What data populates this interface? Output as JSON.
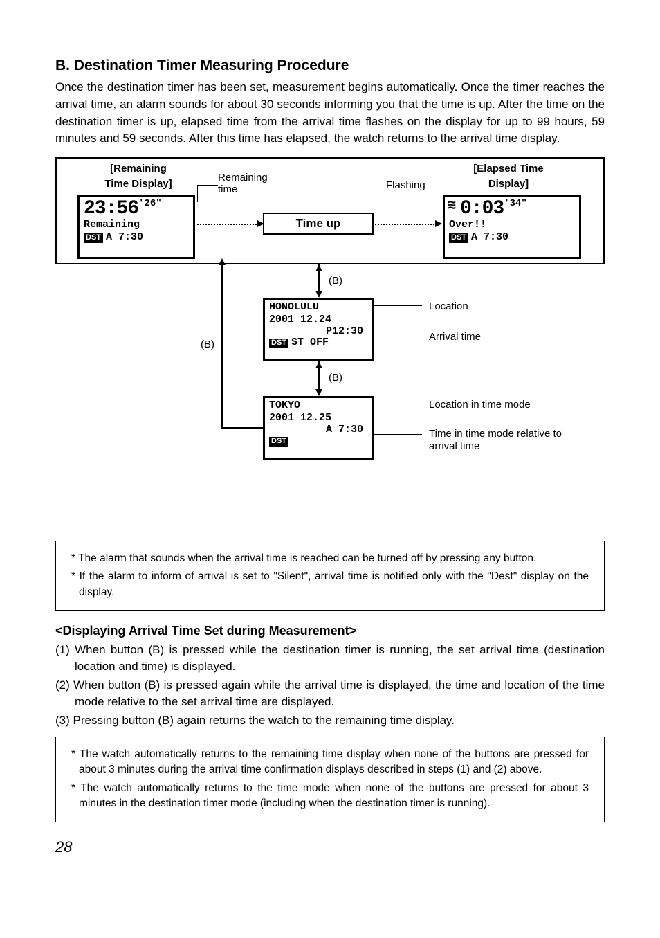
{
  "section": {
    "heading": "B. Destination Timer Measuring Procedure",
    "intro": "Once the destination timer has been set, measurement begins automatically.  Once the timer reaches the arrival time, an alarm sounds for about 30 seconds informing you that the time is up.  After the time on the destination timer is up, elapsed time from the arrival time flashes on the display for up to 99 hours, 59 minutes and 59 seconds.  After this time has elapsed, the watch returns to the arrival time display."
  },
  "labels": {
    "remaining_title1": "[Remaining",
    "remaining_title2": "Time Display]",
    "elapsed_title1": "[Elapsed Time",
    "elapsed_title2": "Display]",
    "remaining_time": "Remaining time",
    "flashing": "Flashing",
    "time_up": "Time up",
    "b": "(B)",
    "location": "Location",
    "arrival_time": "Arrival time",
    "loc_in_time_mode": "Location in time mode",
    "time_mode_rel": "Time in time mode relative to arrival time"
  },
  "lcd": {
    "remaining": {
      "main": "23:56",
      "sec": "'26\"",
      "line2": "Remaining",
      "badge": "DST",
      "line3": "A  7:30"
    },
    "elapsed": {
      "main": "0:03",
      "sec": "'34\"",
      "line2": "Over!!",
      "badge": "DST",
      "line3": "A     7:30"
    },
    "dest": {
      "line1": "HONOLULU",
      "line2": "2001 12.24",
      "line3": "P12:30",
      "badge": "DST",
      "line4": "ST OFF"
    },
    "time": {
      "line1": "TOKYO",
      "line2": "2001 12.25",
      "line3": "A  7:30",
      "badge": "DST"
    }
  },
  "notes1": [
    "* The alarm that sounds when the arrival time is reached can be turned off by pressing any button.",
    "* If the alarm to inform of arrival is set to \"Silent\", arrival time is notified only with the \"Dest\" display on the display."
  ],
  "subheading": "<Displaying Arrival Time Set during Measurement>",
  "steps": [
    "(1) When button (B) is pressed while the destination timer is running, the set arrival time (destination location and time) is displayed.",
    "(2) When button (B) is pressed again while the arrival time is displayed, the time and location of the time mode relative to the set arrival time are displayed.",
    "(3) Pressing button (B) again returns the watch to the remaining time display."
  ],
  "notes2": [
    "* The watch automatically returns to the remaining time display when none of the buttons are pressed for about 3 minutes during the arrival time confirmation displays described in steps (1) and (2) above.",
    "* The watch automatically returns to the time mode when none of the buttons are pressed for about 3 minutes in the destination timer mode (including when the destination timer is running)."
  ],
  "page": "28"
}
